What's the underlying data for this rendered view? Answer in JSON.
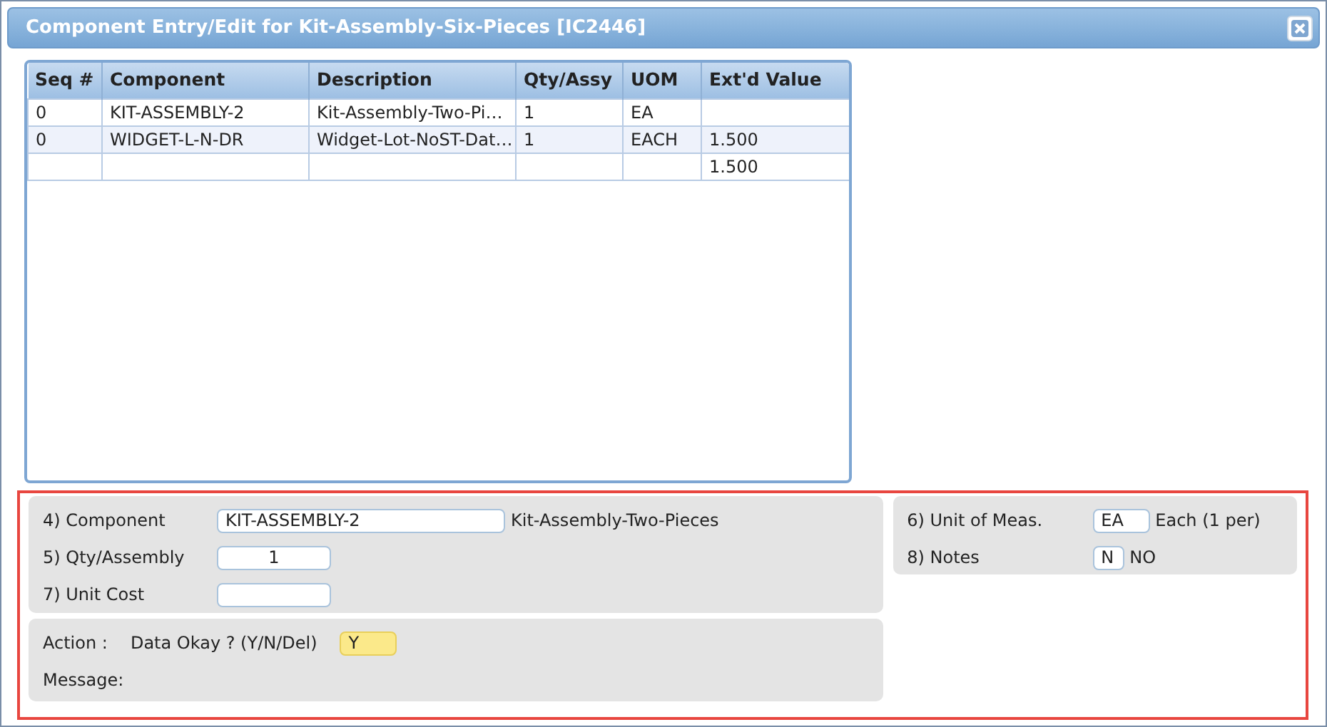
{
  "window": {
    "title": "Component Entry/Edit for Kit-Assembly-Six-Pieces [IC2446]"
  },
  "table": {
    "columns": [
      "Seq #",
      "Component",
      "Description",
      "Qty/Assy",
      "UOM",
      "Ext'd Value"
    ],
    "rows": [
      [
        "0",
        "KIT-ASSEMBLY-2",
        "Kit-Assembly-Two-Pi…",
        "1",
        "EA",
        ""
      ],
      [
        "0",
        "WIDGET-L-N-DR",
        "Widget-Lot-NoST-Dat…",
        "1",
        "EACH",
        "1.500"
      ],
      [
        "",
        "",
        "",
        "",
        "",
        "1.500"
      ]
    ]
  },
  "form": {
    "left": [
      {
        "label": "4) Component",
        "value": "KIT-ASSEMBLY-2",
        "note": "Kit-Assembly-Two-Pieces"
      },
      {
        "label": "5) Qty/Assembly",
        "value": "1"
      },
      {
        "label": "7) Unit Cost"
      }
    ],
    "right": [
      {
        "label": "6) Unit of Meas.",
        "value": "EA",
        "note": "Each (1 per)"
      },
      {
        "label": "8) Notes",
        "value": "N",
        "note": "NO"
      }
    ],
    "action": {
      "label": "Action :",
      "prompt": "Data Okay ? (Y/N/Del)",
      "value": "Y",
      "focused": true,
      "message_label": "Message:"
    }
  },
  "highlighted": true
}
